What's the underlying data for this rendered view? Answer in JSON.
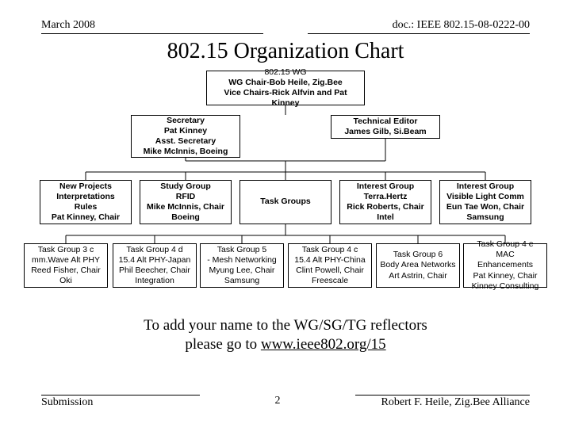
{
  "header": {
    "left": "March 2008",
    "right": "doc.: IEEE 802.15-08-0222-00"
  },
  "title": "802.15 Organization Chart",
  "org": {
    "top": {
      "l1": "802.15 WG",
      "l2": "WG Chair-Bob Heile, Zig.Bee",
      "l3": "Vice Chairs-Rick Alfvin and Pat Kinney"
    },
    "sec": {
      "l1": "Secretary",
      "l2": "Pat Kinney",
      "l3": "Asst. Secretary",
      "l4": "Mike McInnis, Boeing"
    },
    "ted": {
      "l1": "Technical Editor",
      "l2": "James Gilb, Si.Beam"
    },
    "row2": [
      {
        "l1": "New Projects",
        "l2": "Interpretations",
        "l3": "Rules",
        "l4": "Pat Kinney, Chair"
      },
      {
        "l1": "Study Group",
        "l2": "RFID",
        "l3": "Mike McInnis, Chair",
        "l4": "Boeing"
      },
      {
        "l1": "Task Groups",
        "l2": "",
        "l3": "",
        "l4": ""
      },
      {
        "l1": "Interest Group",
        "l2": "Terra.Hertz",
        "l3": "Rick Roberts, Chair",
        "l4": "Intel"
      },
      {
        "l1": "Interest Group",
        "l2": "Visible Light Comm",
        "l3": "Eun Tae Won, Chair",
        "l4": "Samsung"
      }
    ],
    "row3": [
      {
        "l1": "Task Group 3 c",
        "l2": "mm.Wave Alt PHY",
        "l3": "Reed Fisher, Chair",
        "l4": "Oki"
      },
      {
        "l1": "Task Group 4 d",
        "l2": "15.4 Alt PHY-Japan",
        "l3": "Phil Beecher, Chair",
        "l4": "Integration"
      },
      {
        "l1": "Task Group 5",
        "l2": "- Mesh Networking",
        "l3": "Myung Lee, Chair",
        "l4": "Samsung"
      },
      {
        "l1": "Task Group 4 c",
        "l2": "15.4 Alt PHY-China",
        "l3": "Clint Powell, Chair",
        "l4": "Freescale"
      },
      {
        "l1": "Task Group 6",
        "l2": "Body Area Networks",
        "l3": "Art Astrin, Chair",
        "l4": ""
      },
      {
        "l1": "Task Group 4 e",
        "l2": "MAC Enhancements",
        "l3": "Pat Kinney, Chair",
        "l4": "Kinney Consulting"
      }
    ]
  },
  "note": {
    "l1": "To add your name to the WG/SG/TG reflectors",
    "l2a": "please go to ",
    "l2b": "www.ieee802.org/15"
  },
  "footer": {
    "left": "Submission",
    "center": "2",
    "right": "Robert F. Heile, Zig.Bee Alliance"
  }
}
